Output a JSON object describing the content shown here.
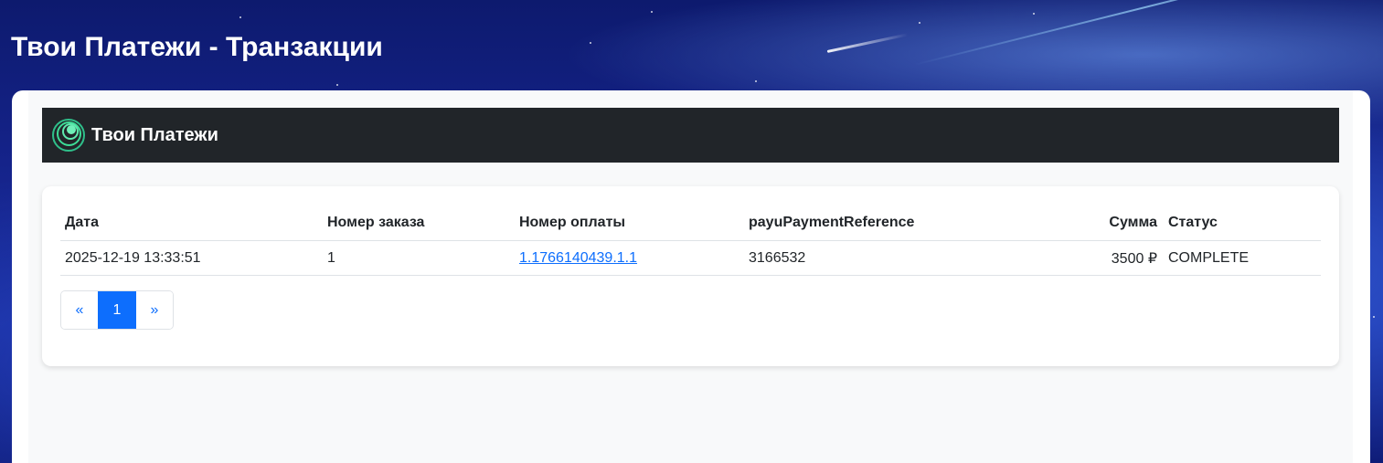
{
  "page": {
    "heading": "Твои Платежи - Транзакции"
  },
  "navbar": {
    "brand_name": "Твои Платежи",
    "logo_icon": "ring-logo-icon",
    "logo_color": "#3ddc97"
  },
  "table": {
    "headers": {
      "date": "Дата",
      "order": "Номер заказа",
      "payment": "Номер оплаты",
      "reference": "payuPaymentReference",
      "amount": "Сумма",
      "status": "Статус"
    },
    "rows": [
      {
        "date": "2025-12-19 13:33:51",
        "order": "1",
        "payment": "1.1766140439.1.1",
        "reference": "3166532",
        "amount": "3500 ₽",
        "status": "COMPLETE"
      }
    ]
  },
  "pagination": {
    "prev": "«",
    "current": "1",
    "next": "»"
  },
  "colors": {
    "accent": "#0d6efd",
    "navbar_bg": "#212529",
    "background": "#15238a"
  }
}
